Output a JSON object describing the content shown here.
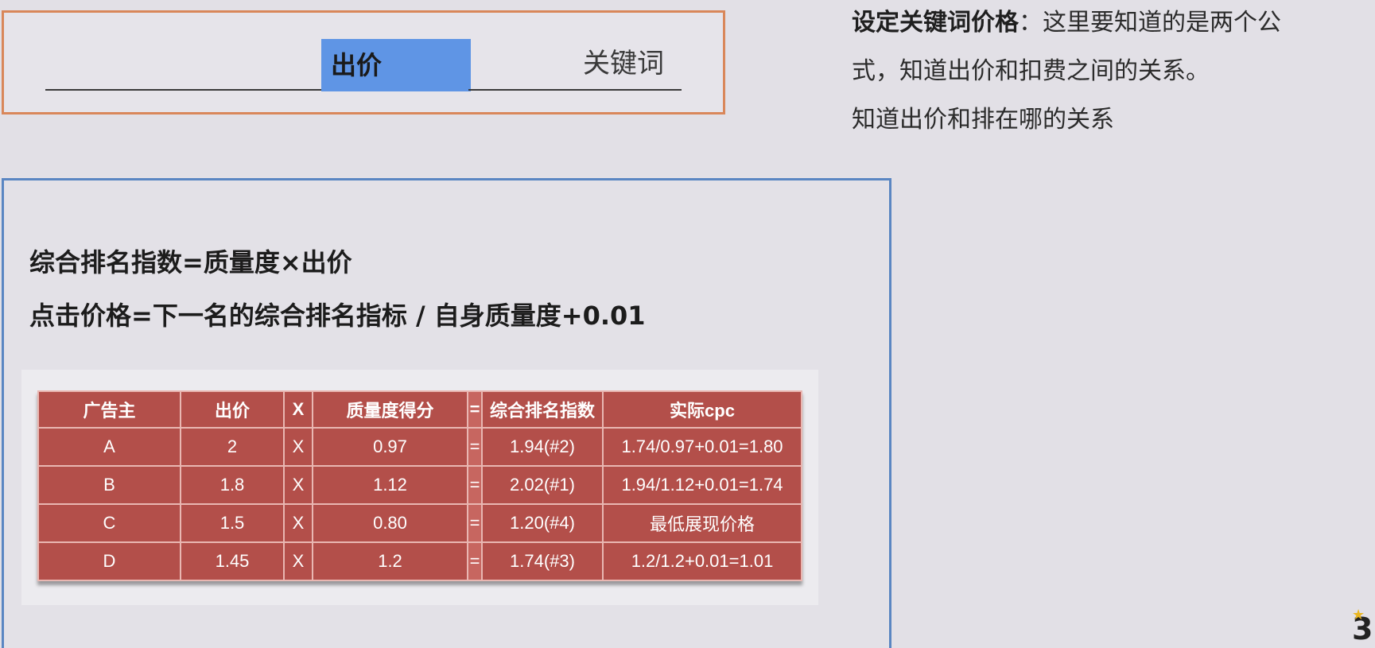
{
  "top_box": {
    "bid_label": "出价",
    "keyword_label": "关键词"
  },
  "side_note": {
    "title": "设定关键词价格",
    "separator": "：",
    "line1_rest": "这里要知道的是两个公",
    "line2": "式，知道出价和扣费之间的关系。",
    "line3": "知道出价和排在哪的关系"
  },
  "formulas": {
    "rank_index": "综合排名指数=质量度×出价",
    "click_price": "点击价格=下一名的综合排名指标 / 自身质量度+0.01"
  },
  "table": {
    "headers": [
      "广告主",
      "出价",
      "X",
      "质量度得分",
      "=",
      "综合排名指数",
      "实际cpc"
    ],
    "rows": [
      [
        "A",
        "2",
        "X",
        "0.97",
        "=",
        "1.94(#2)",
        "1.74/0.97+0.01=1.80"
      ],
      [
        "B",
        "1.8",
        "X",
        "1.12",
        "=",
        "2.02(#1)",
        "1.94/1.12+0.01=1.74"
      ],
      [
        "C",
        "1.5",
        "X",
        "0.80",
        "=",
        "1.20(#4)",
        "最低展现价格"
      ],
      [
        "D",
        "1.45",
        "X",
        "1.2",
        "=",
        "1.74(#3)",
        "1.2/1.2+0.01=1.01"
      ]
    ]
  },
  "logo": {
    "glyph": "3",
    "star_icon": "star-icon"
  },
  "colors": {
    "table_red": "#b34f4a",
    "top_box_border": "#d9875a",
    "main_box_border": "#5a86c2",
    "highlight_blue": "#5f95e5"
  }
}
